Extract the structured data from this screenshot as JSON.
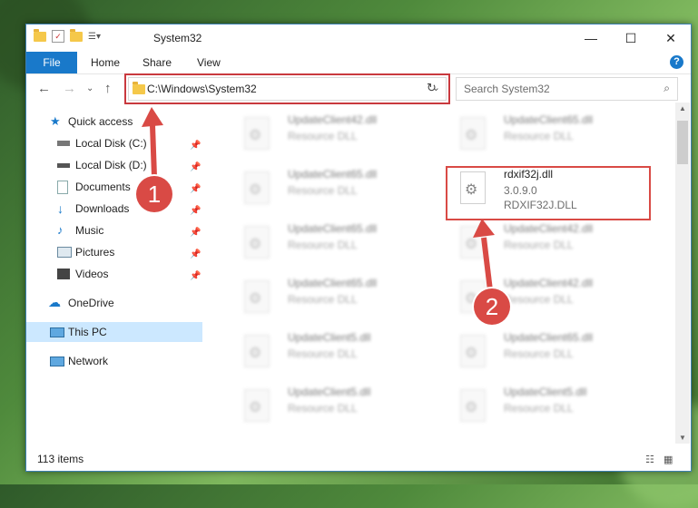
{
  "window": {
    "title": "System32"
  },
  "ribbon": {
    "file": "File",
    "tabs": [
      "Home",
      "Share",
      "View"
    ],
    "help": "?"
  },
  "nav": {
    "address": "C:\\Windows\\System32",
    "search_placeholder": "Search System32"
  },
  "sidebar": {
    "items": [
      {
        "label": "Quick access"
      },
      {
        "label": "Local Disk (C:)"
      },
      {
        "label": "Local Disk (D:)"
      },
      {
        "label": "Documents"
      },
      {
        "label": "Downloads"
      },
      {
        "label": "Music"
      },
      {
        "label": "Pictures"
      },
      {
        "label": "Videos"
      },
      {
        "label": "OneDrive"
      },
      {
        "label": "This PC"
      },
      {
        "label": "Network"
      }
    ]
  },
  "files": [
    {
      "name": "UpdateClient42.dll",
      "line1": "Resource DLL"
    },
    {
      "name": "UpdateClient65.dll",
      "line1": "Resource DLL"
    },
    {
      "name": "UpdateClient65.dll",
      "line1": "Resource DLL"
    },
    {
      "name": "rdxif32j.dll",
      "line1": "3.0.9.0",
      "line2": "RDXIF32J.DLL"
    },
    {
      "name": "UpdateClient65.dll",
      "line1": "Resource DLL"
    },
    {
      "name": "UpdateClient42.dll",
      "line1": "Resource DLL"
    },
    {
      "name": "UpdateClient65.dll",
      "line1": "Resource DLL"
    },
    {
      "name": "UpdateClient42.dll",
      "line1": "Resource DLL"
    },
    {
      "name": "UpdateClient5.dll",
      "line1": "Resource DLL"
    },
    {
      "name": "UpdateClient65.dll",
      "line1": "Resource DLL"
    },
    {
      "name": "UpdateClient5.dll",
      "line1": "Resource DLL"
    },
    {
      "name": "UpdateClient5.dll",
      "line1": "Resource DLL"
    }
  ],
  "status": {
    "count": "113 items"
  },
  "annotations": {
    "step1": "1",
    "step2": "2",
    "highlight_color": "#d94a45"
  }
}
